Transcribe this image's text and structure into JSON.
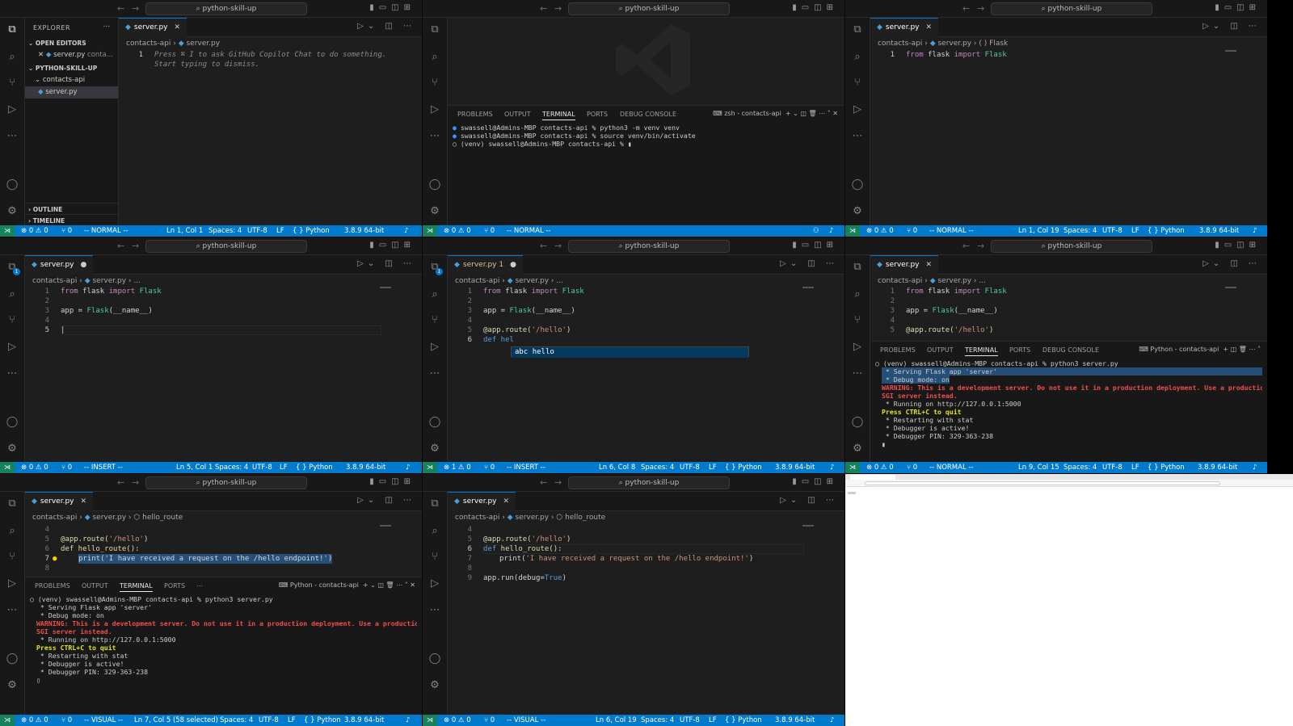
{
  "title": "python-skill-up",
  "file_name": "server.py",
  "folder": "contacts-api",
  "breadcrumb_sep": "›",
  "symbol": "hello_route",
  "flask_symbol": "Flask",
  "ellipsis": "...",
  "copilot_hint": "Press ⌘ I to ask GitHub Copilot Chat to do something.",
  "copilot_hint2": "Start typing to dismiss.",
  "explorer": {
    "title": "EXPLORER",
    "open_editors": "OPEN EDITORS",
    "open_item": "server.py",
    "open_item_dir": "conta...",
    "project": "PYTHON-SKILL-UP",
    "folder": "contacts-api",
    "file": "server.py",
    "outline": "OUTLINE",
    "timeline": "TIMELINE"
  },
  "code": {
    "l1": "from flask import Flask",
    "l3": "app = Flask(__name__)",
    "l5": "@app.route('/hello')",
    "l6_partial": "def hel",
    "l6": "def hello_route():",
    "l7": "print('I have received a request on the /hello endpoint!')",
    "l9": "app.run(debug=True)"
  },
  "suggestion": "hello",
  "panel_tabs": [
    "PROBLEMS",
    "OUTPUT",
    "TERMINAL",
    "PORTS",
    "DEBUG CONSOLE"
  ],
  "terminal_zsh": "zsh - contacts-api",
  "terminal_py": "Python - contacts-api",
  "term1": [
    "swassell@Admins-MBP contacts-api % python3 -m venv venv",
    "swassell@Admins-MBP contacts-api % source venv/bin/activate",
    "(venv) swassell@Admins-MBP contacts-api % "
  ],
  "term2": {
    "cmd": "(venv) swassell@Admins-MBP contacts-api % python3 server.py",
    "serving": " * Serving Flask app 'server'",
    "debug": " * Debug mode: on",
    "warn1": "WARNING: This is a development server. Do not use it in a production deployment. Use a production W",
    "warn2": "SGI server instead.",
    "running": " * Running on http://127.0.0.1:5000",
    "quit": "Press CTRL+C to quit",
    "restart": " * Restarting with stat",
    "debugger": " * Debugger is active!",
    "pin": " * Debugger PIN: 329-363-238"
  },
  "status": {
    "problems": "⊗ 0 ⚠ 0",
    "problems_err": "⊗ 1 ⚠ 0",
    "ports": "⑂ 0",
    "normal": "-- NORMAL --",
    "insert": "-- INSERT --",
    "visual": "-- VISUAL --",
    "pos_11": "Ln 1, Col 1",
    "pos_119": "Ln 1, Col 19",
    "pos_51": "Ln 5, Col 1",
    "pos_68": "Ln 6, Col 8",
    "pos_915": "Ln 9, Col 15",
    "pos_75": "Ln 7, Col 5 (58 selected)",
    "pos_619": "Ln 6, Col 19",
    "spaces": "Spaces: 4",
    "enc": "UTF-8",
    "eol": "LF",
    "lang": "{ } Python",
    "interp": "3.8.9 64-bit"
  }
}
